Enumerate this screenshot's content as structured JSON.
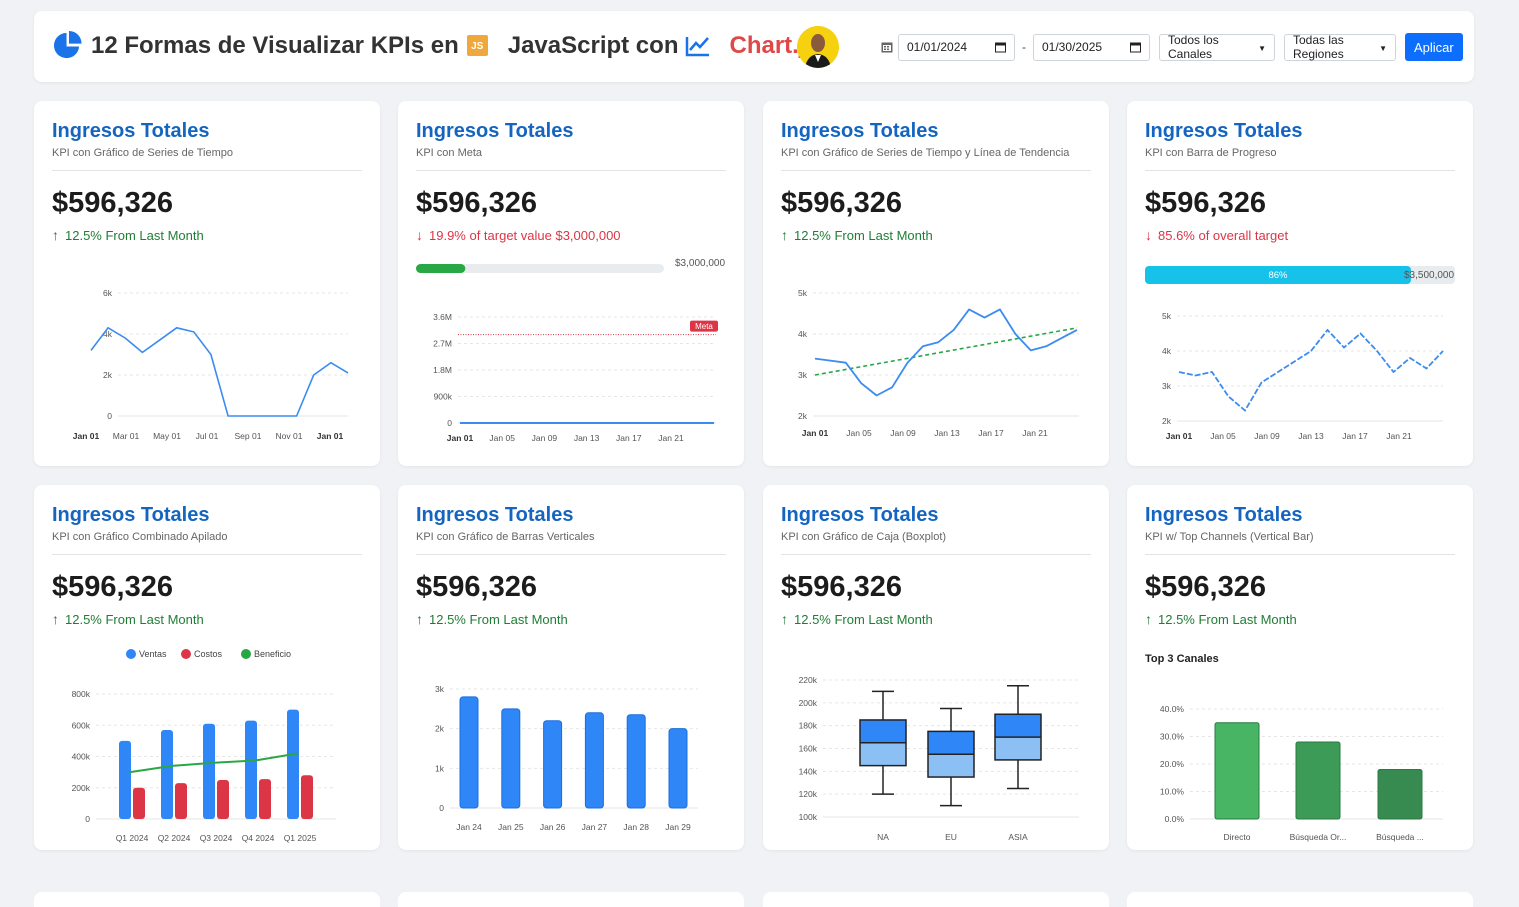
{
  "header": {
    "title_part1": "12 Formas de Visualizar KPIs en",
    "js_badge": "JS",
    "title_part2": "JavaScript con",
    "title_brand": "Chart.js",
    "date_from": "01/01/2024",
    "date_sep": "-",
    "date_to": "01/30/2025",
    "channel_select": "Todos los Canales",
    "region_select": "Todas las Regiones",
    "apply_label": "Aplicar",
    "icons": [
      "pie-chart-icon",
      "line-chart-icon",
      "calendar-icon"
    ],
    "colors": {
      "brand": "#e04848",
      "primary": "#0d6efd",
      "title": "#1565c0"
    }
  },
  "cards": [
    {
      "title": "Ingresos Totales",
      "subtitle": "KPI con Gráfico de Series de Tiempo",
      "value": "$596,326",
      "change": "12.5% From Last Month",
      "direction": "up"
    },
    {
      "title": "Ingresos Totales",
      "subtitle": "KPI con Meta",
      "value": "$596,326",
      "change": "19.9% of target value $3,000,000",
      "direction": "down",
      "target_label": "$3,000,000",
      "progress_fraction": 0.199
    },
    {
      "title": "Ingresos Totales",
      "subtitle": "KPI con Gráfico de Series de Tiempo y Línea de Tendencia",
      "value": "$596,326",
      "change": "12.5% From Last Month",
      "direction": "up"
    },
    {
      "title": "Ingresos Totales",
      "subtitle": "KPI con Barra de Progreso",
      "value": "$596,326",
      "change": "85.6% of overall target",
      "direction": "down",
      "progress_label": "86%",
      "progress_fraction": 0.86,
      "target_label": "$3,500,000"
    },
    {
      "title": "Ingresos Totales",
      "subtitle": "KPI con Gráfico Combinado Apilado",
      "value": "$596,326",
      "change": "12.5% From Last Month",
      "direction": "up"
    },
    {
      "title": "Ingresos Totales",
      "subtitle": "KPI con Gráfico de Barras Verticales",
      "value": "$596,326",
      "change": "12.5% From Last Month",
      "direction": "up"
    },
    {
      "title": "Ingresos Totales",
      "subtitle": "KPI con Gráfico de Caja (Boxplot)",
      "value": "$596,326",
      "change": "12.5% From Last Month",
      "direction": "up"
    },
    {
      "title": "Ingresos Totales",
      "subtitle": "KPI w/ Top Channels (Vertical Bar)",
      "value": "$596,326",
      "change": "12.5% From Last Month",
      "direction": "up",
      "chart_title": "Top 3 Canales"
    }
  ],
  "chart_data": [
    {
      "type": "line",
      "x_ticks": [
        "Jan 01",
        "Mar 01",
        "May 01",
        "Jul 01",
        "Sep 01",
        "Nov 01",
        "Jan 01"
      ],
      "y_ticks": [
        "0",
        "2k",
        "4k",
        "6k"
      ],
      "ylim": [
        0,
        6000
      ],
      "series": [
        {
          "values": [
            3200,
            4300,
            3800,
            3100,
            3700,
            4300,
            4100,
            3000,
            0,
            0,
            0,
            0,
            0,
            2000,
            2600,
            2100
          ]
        }
      ],
      "grid": true
    },
    {
      "type": "line",
      "x_ticks": [
        "Jan 01",
        "Jan 05",
        "Jan 09",
        "Jan 13",
        "Jan 17",
        "Jan 21"
      ],
      "y_ticks": [
        "0",
        "900k",
        "1.8M",
        "2.7M",
        "3.6M"
      ],
      "ylim": [
        0,
        3600000
      ],
      "series": [
        {
          "values": [
            0,
            0,
            0,
            0,
            0,
            0,
            0
          ]
        }
      ],
      "target_line": 3000000,
      "target_label": "Meta",
      "grid": true
    },
    {
      "type": "line",
      "x_ticks": [
        "Jan 01",
        "Jan 05",
        "Jan 09",
        "Jan 13",
        "Jan 17",
        "Jan 21"
      ],
      "y_ticks": [
        "2k",
        "3k",
        "4k",
        "5k"
      ],
      "ylim": [
        2000,
        5000
      ],
      "series": [
        {
          "values": [
            3400,
            3350,
            3300,
            2800,
            2500,
            2700,
            3300,
            3700,
            3800,
            4100,
            4600,
            4400,
            4600,
            4000,
            3600,
            3700,
            3900,
            4100
          ]
        }
      ],
      "trend": [
        3000,
        4150
      ],
      "grid": true
    },
    {
      "type": "line",
      "x_ticks": [
        "Jan 01",
        "Jan 05",
        "Jan 09",
        "Jan 13",
        "Jan 17",
        "Jan 21"
      ],
      "y_ticks": [
        "2k",
        "3k",
        "4k",
        "5k"
      ],
      "ylim": [
        2000,
        5000
      ],
      "series": [
        {
          "values": [
            3400,
            3300,
            3400,
            2700,
            2300,
            3100,
            3400,
            3700,
            4000,
            4600,
            4100,
            4500,
            4000,
            3400,
            3800,
            3500,
            4000
          ]
        }
      ],
      "grid": true
    },
    {
      "type": "bar",
      "categories": [
        "Q1 2024",
        "Q2 2024",
        "Q3 2024",
        "Q4 2024",
        "Q1 2025"
      ],
      "y_ticks": [
        "0",
        "200k",
        "400k",
        "600k",
        "800k"
      ],
      "ylim": [
        0,
        800000
      ],
      "series": [
        {
          "name": "Ventas",
          "values": [
            500000,
            570000,
            610000,
            630000,
            700000
          ],
          "color": "#2f86f6"
        },
        {
          "name": "Costos",
          "values": [
            200000,
            230000,
            250000,
            255000,
            280000
          ],
          "color": "#dc3545"
        },
        {
          "name": "Beneficio",
          "values": [
            300000,
            340000,
            360000,
            375000,
            420000
          ],
          "color": "#28a745"
        }
      ],
      "legend": "top",
      "grid": true
    },
    {
      "type": "bar",
      "categories": [
        "Jan 24",
        "Jan 25",
        "Jan 26",
        "Jan 27",
        "Jan 28",
        "Jan 29"
      ],
      "y_ticks": [
        "0",
        "1k",
        "2k",
        "3k"
      ],
      "ylim": [
        0,
        3000
      ],
      "values": [
        2800,
        2500,
        2200,
        2400,
        2350,
        2000
      ],
      "grid": true
    },
    {
      "type": "boxplot",
      "categories": [
        "NA",
        "EU",
        "ASIA"
      ],
      "y_ticks": [
        "100k",
        "120k",
        "140k",
        "160k",
        "180k",
        "200k",
        "220k"
      ],
      "ylim": [
        100000,
        220000
      ],
      "boxes": [
        {
          "min": 120000,
          "q1": 145000,
          "median": 165000,
          "q3": 185000,
          "max": 210000
        },
        {
          "min": 110000,
          "q1": 135000,
          "median": 155000,
          "q3": 175000,
          "max": 195000
        },
        {
          "min": 125000,
          "q1": 150000,
          "median": 170000,
          "q3": 190000,
          "max": 215000
        }
      ],
      "grid": true
    },
    {
      "type": "bar",
      "title": "Top 3 Canales",
      "categories": [
        "Directo",
        "Búsqueda Or...",
        "Búsqueda ..."
      ],
      "y_ticks": [
        "0.0%",
        "10.0%",
        "20.0%",
        "30.0%",
        "40.0%"
      ],
      "ylim": [
        0,
        40
      ],
      "values": [
        35,
        28,
        18
      ],
      "colors": [
        "#48b565",
        "#3d9b58",
        "#378a50"
      ],
      "grid": true
    }
  ]
}
